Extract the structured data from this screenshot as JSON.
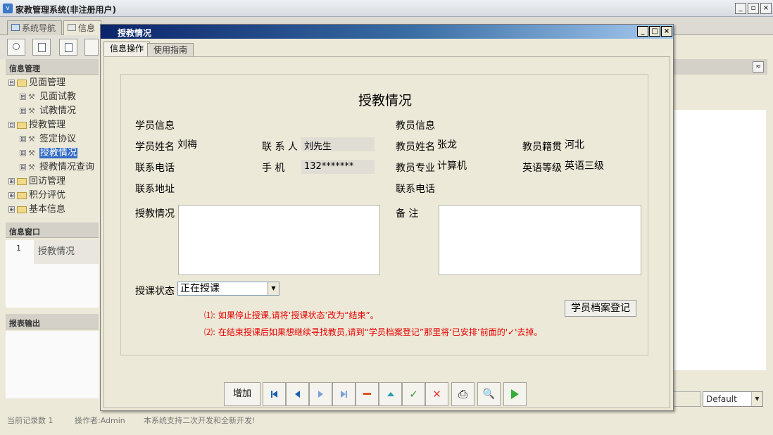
{
  "app": {
    "title": "家教管理系统(非注册用户)",
    "window_buttons": [
      "_",
      "▫",
      "×"
    ]
  },
  "main_tabs": [
    {
      "label": "系统导航"
    },
    {
      "label": "信息"
    }
  ],
  "left_panel": {
    "info_manage_header": "信息管理",
    "tree": [
      {
        "label": "见面管理",
        "level": 0,
        "type": "folder",
        "toggle": "⊟"
      },
      {
        "label": "见面试教",
        "level": 1,
        "type": "item",
        "toggle": "⊞"
      },
      {
        "label": "试教情况",
        "level": 1,
        "type": "item",
        "toggle": "⊞"
      },
      {
        "label": "授教管理",
        "level": 0,
        "type": "folder",
        "toggle": "⊟"
      },
      {
        "label": "签定协议",
        "level": 1,
        "type": "item",
        "toggle": "⊞"
      },
      {
        "label": "授教情况",
        "level": 1,
        "type": "item",
        "toggle": "⊞",
        "selected": true
      },
      {
        "label": "授教情况查询",
        "level": 1,
        "type": "item",
        "toggle": "⊞"
      },
      {
        "label": "回访管理",
        "level": 0,
        "type": "folder",
        "toggle": "⊞"
      },
      {
        "label": "积分评优",
        "level": 0,
        "type": "folder",
        "toggle": "⊞"
      },
      {
        "label": "基本信息",
        "level": 0,
        "type": "folder",
        "toggle": "⊞"
      }
    ],
    "info_window_header": "信息窗口",
    "info_window_row": {
      "num": "1",
      "label": "授教情况"
    },
    "report_header": "报表输出"
  },
  "status_bar": {
    "records": "当前记录数 1",
    "operator": "操作者:Admin",
    "message": "本系统支持二次开发和全新开发!"
  },
  "right_side": {
    "combo_value": "Default",
    "collapse_glyph": "≈"
  },
  "dialog": {
    "title": "授教情况",
    "tabs": [
      {
        "label": "信息操作",
        "active": true
      },
      {
        "label": "使用指南",
        "active": false
      }
    ],
    "form": {
      "title": "授教情况",
      "student_section": "学员信息",
      "teacher_section": "教员信息",
      "student_name_label": "学员姓名",
      "student_name": "刘梅",
      "contact_label": "联 系 人",
      "contact": "刘先生",
      "phone_label": "联系电话",
      "mobile_label": "手 机",
      "mobile": "132*******",
      "address_label": "联系地址",
      "teacher_name_label": "教员姓名",
      "teacher_name": "张龙",
      "teacher_origin_label": "教员籍贯",
      "teacher_origin": "河北",
      "teacher_major_label": "教员专业",
      "teacher_major": "计算机",
      "english_level_label": "英语等级",
      "english_level": "英语三级",
      "teacher_phone_label": "联系电话",
      "teaching_status_text_label": "授教情况",
      "remarks_label": "备 注",
      "course_status_label": "授课状态",
      "course_status": "正在授课",
      "archive_button": "学员档案登记",
      "note1": "⑴: 如果停止授课,请将‘授课状态’改为“结束”。",
      "note2": "⑵: 在结束授课后如果想继续寻找教员,请到“学员档案登记”那里将‘已安排’前面的'✓'去掉。"
    },
    "navigator": {
      "add_label": "增加",
      "buttons": [
        "first",
        "prior",
        "next",
        "last",
        "delete",
        "edit",
        "post",
        "cancel",
        "print",
        "preview",
        "run"
      ]
    }
  }
}
